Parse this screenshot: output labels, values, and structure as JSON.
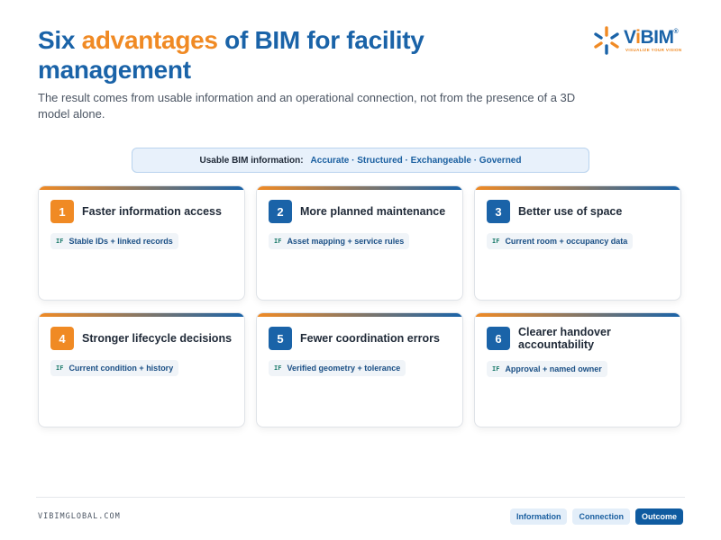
{
  "header": {
    "title_part1": "Six ",
    "title_accent": "advantages",
    "title_part2": " of BIM for facility management",
    "subtitle": "The result comes from usable information and an operational connection, not from the presence of a 3D model alone."
  },
  "logo": {
    "word_prefix": "V",
    "word_accent": "i",
    "word_suffix": "BIM",
    "registered": "®",
    "tagline": "VISUALIZE YOUR VISION",
    "icon": "vibim-star-logo-icon"
  },
  "banner": {
    "label": "Usable BIM information:",
    "values": "Accurate · Structured · Exchangeable · Governed"
  },
  "cards": [
    {
      "number": "1",
      "title": "Faster information access",
      "condition_prefix": "IF",
      "condition": "Stable IDs + linked records"
    },
    {
      "number": "2",
      "title": "More planned maintenance",
      "condition_prefix": "IF",
      "condition": "Asset mapping + service rules"
    },
    {
      "number": "3",
      "title": "Better use of space",
      "condition_prefix": "IF",
      "condition": "Current room + occupancy data"
    },
    {
      "number": "4",
      "title": "Stronger lifecycle decisions",
      "condition_prefix": "IF",
      "condition": "Current condition + history"
    },
    {
      "number": "5",
      "title": "Fewer coordination errors",
      "condition_prefix": "IF",
      "condition": "Verified geometry + tolerance"
    },
    {
      "number": "6",
      "title": "Clearer handover accountability",
      "condition_prefix": "IF",
      "condition": "Approval + named owner"
    }
  ],
  "footer": {
    "site": "VIBIMGLOBAL.COM",
    "pills": [
      "Information",
      "Connection",
      "Outcome"
    ],
    "active_pill": "Outcome"
  },
  "colors": {
    "brand_blue": "#1a63a8",
    "brand_orange": "#f08a24"
  }
}
